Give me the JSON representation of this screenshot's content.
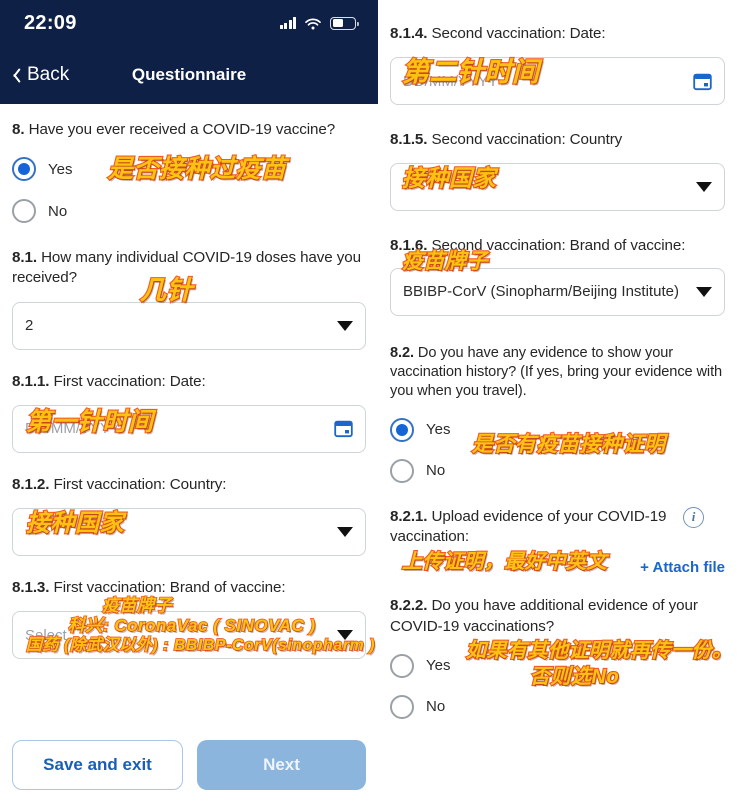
{
  "status_bar": {
    "time": "22:09",
    "signal_icon": "signal-bars-icon",
    "wifi_icon": "wifi-icon",
    "battery_icon": "battery-icon"
  },
  "nav": {
    "back_label": "Back",
    "back_icon": "chevron-left-icon",
    "title": "Questionnaire"
  },
  "colors": {
    "header_bg": "#0f2047",
    "accent_blue": "#1565d8",
    "link_blue": "#1a66c9",
    "annotation_fill": "#FFC211",
    "annotation_stroke": "#F15A22",
    "primary_button": "#8cb5de"
  },
  "left_column": {
    "q8": {
      "number": "8.",
      "text": "Have you ever received a COVID-19 vaccine?",
      "annotation": "是否接种过疫苗",
      "options": [
        {
          "label": "Yes",
          "selected": true
        },
        {
          "label": "No",
          "selected": false
        }
      ]
    },
    "q81": {
      "number": "8.1.",
      "text": "How many individual COVID-19 doses have you received?",
      "annotation": "几针",
      "value": "2",
      "caret_icon": "chevron-down-icon"
    },
    "q811": {
      "number": "8.1.1.",
      "text": "First vaccination: Date:",
      "annotation": "第一针时间",
      "placeholder": "DD/MM/YYYY",
      "value": "",
      "calendar_icon": "calendar-icon"
    },
    "q812": {
      "number": "8.1.2.",
      "text": "First vaccination: Country:",
      "annotation": "接种国家",
      "value": "",
      "caret_icon": "chevron-down-icon"
    },
    "q813": {
      "number": "8.1.3.",
      "text": "First vaccination: Brand of vaccine:",
      "annotation_line1": "疫苗牌子",
      "annotation_line2": "科兴: CoronaVac ( SINOVAC )",
      "annotation_line3": "国药 (除武汉以外) : BBIBP-CorV(sinopharm )",
      "placeholder": "Select",
      "caret_icon": "chevron-down-icon"
    },
    "buttons": {
      "save_label": "Save and exit",
      "next_label": "Next"
    }
  },
  "right_column": {
    "q814": {
      "number": "8.1.4.",
      "text": "Second vaccination: Date:",
      "annotation": "第二针时间",
      "placeholder": "DD/MM/YYYY",
      "value": "",
      "calendar_icon": "calendar-icon"
    },
    "q815": {
      "number": "8.1.5.",
      "text": "Second vaccination: Country",
      "annotation": "接种国家",
      "value": "",
      "caret_icon": "chevron-down-icon"
    },
    "q816": {
      "number": "8.1.6.",
      "text": "Second vaccination: Brand of vaccine:",
      "annotation": "疫苗牌子",
      "value": "BBIBP-CorV (Sinopharm/Beijing Institute)",
      "caret_icon": "chevron-down-icon"
    },
    "q82": {
      "number": "8.2.",
      "text": "Do you have any evidence to show your vaccination history? (If yes, bring your evidence with you when you travel).",
      "annotation": "是否有疫苗接种证明",
      "options": [
        {
          "label": "Yes",
          "selected": true
        },
        {
          "label": "No",
          "selected": false
        }
      ]
    },
    "q821": {
      "number": "8.2.1.",
      "text": "Upload evidence of your COVID-19 vaccination:",
      "annotation": "上传证明，最好中英文",
      "info_icon": "info-icon",
      "attach_label": "+ Attach file"
    },
    "q822": {
      "number": "8.2.2.",
      "text": "Do you have additional evidence of your COVID-19 vaccinations?",
      "annotation_line1": "如果有其他证明就再传一份。",
      "annotation_line2": "否则选No",
      "options": [
        {
          "label": "Yes",
          "selected": false
        },
        {
          "label": "No",
          "selected": false
        }
      ]
    }
  }
}
